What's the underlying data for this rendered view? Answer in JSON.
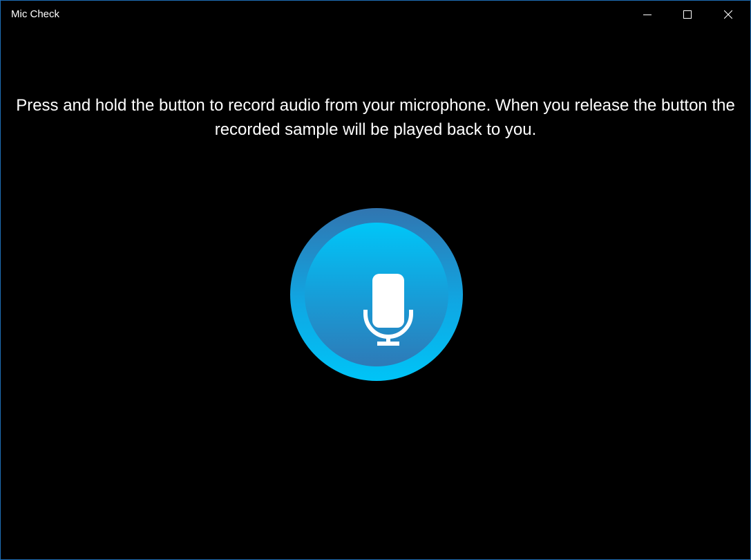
{
  "window": {
    "title": "Mic Check",
    "accent_color": "#1f6fb8",
    "background_color": "#000000"
  },
  "controls": {
    "minimize_icon": "minimize-icon",
    "maximize_icon": "maximize-icon",
    "close_icon": "close-icon"
  },
  "main": {
    "instructions": "Press and hold the button to record audio from your microphone. When you release the button the recorded sample will be played back to you.",
    "record_button": {
      "icon": "microphone-icon",
      "outer_color_top": "#3175b0",
      "outer_color_bottom": "#00c4f7",
      "inner_color_top": "#00c6f8",
      "inner_color_bottom": "#2e7ab7"
    }
  }
}
